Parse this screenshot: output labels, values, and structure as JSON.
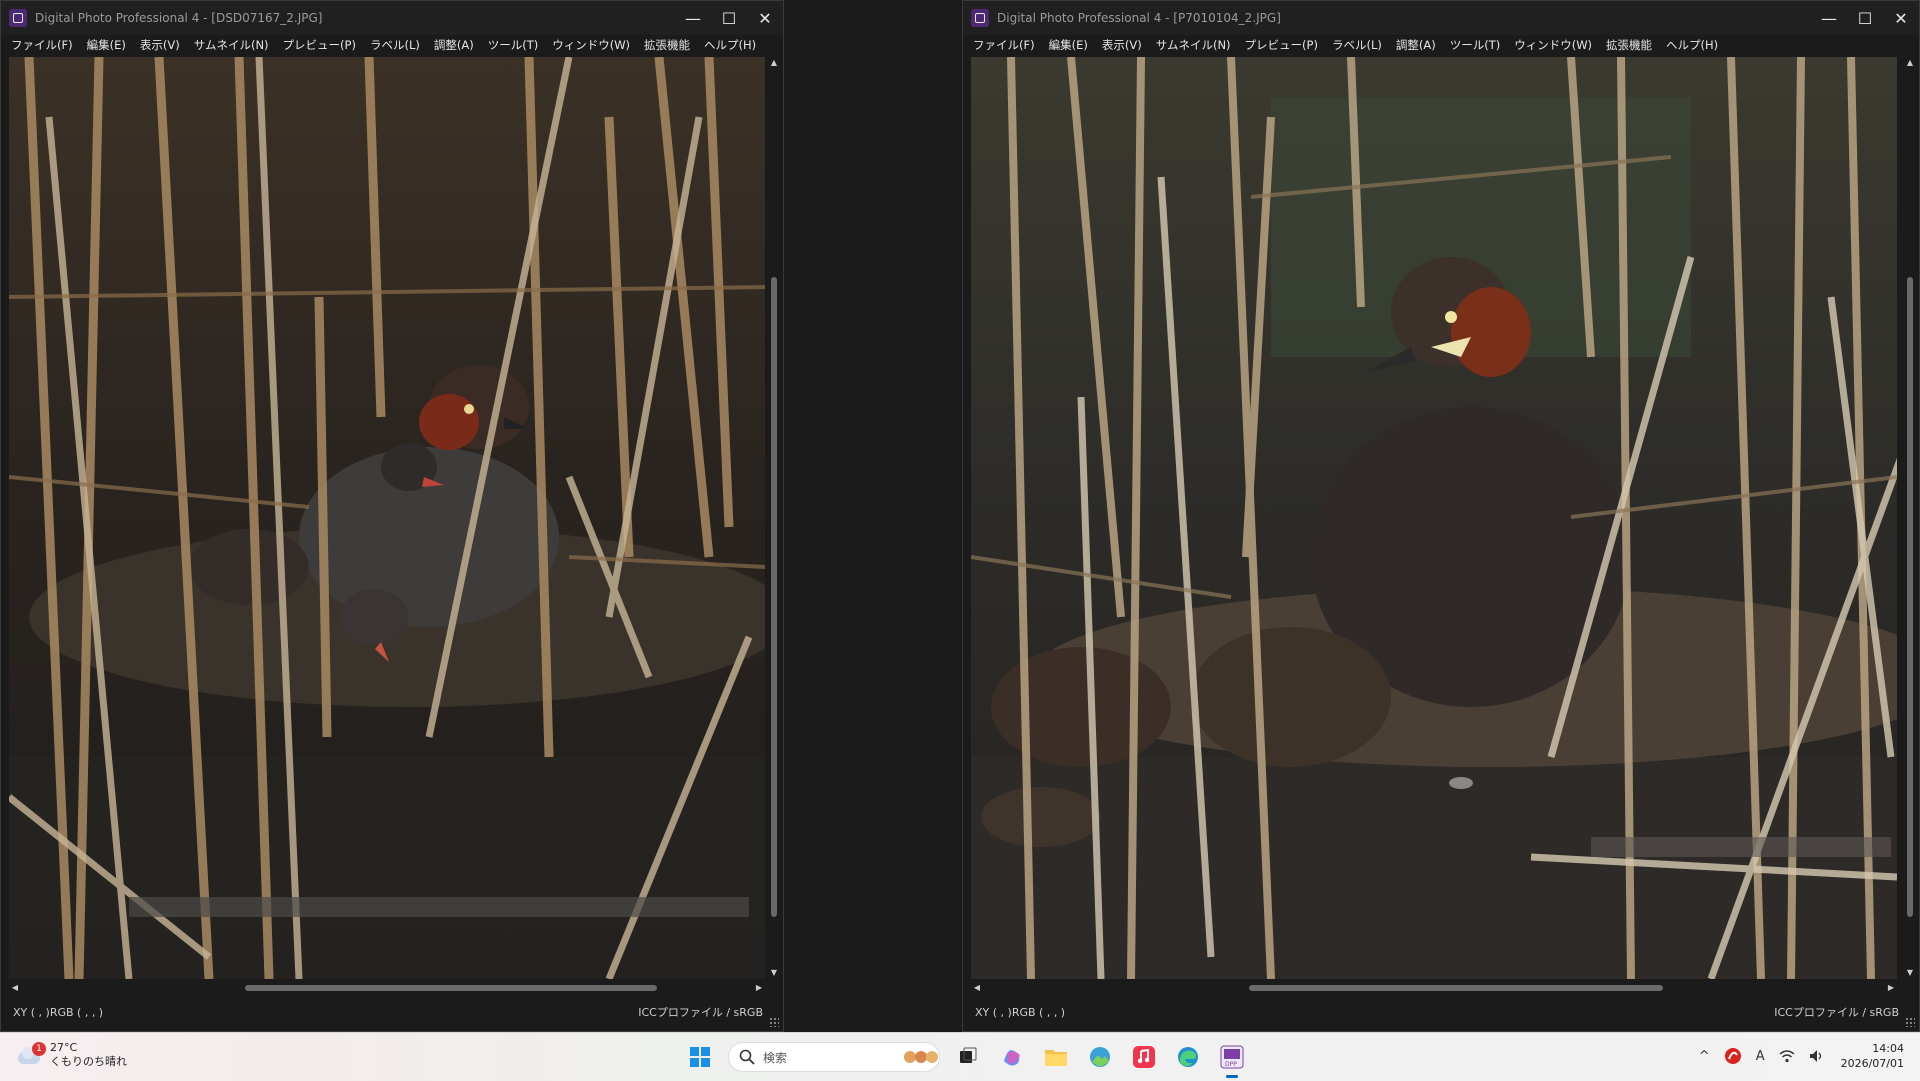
{
  "windows": [
    {
      "title": "Digital Photo Professional 4 - [DSD07167_2.JPG]",
      "menu": [
        "ファイル(F)",
        "編集(E)",
        "表示(V)",
        "サムネイル(N)",
        "プレビュー(P)",
        "ラベル(L)",
        "調整(A)",
        "ツール(T)",
        "ウィンドウ(W)",
        "拡張機能",
        "ヘルプ(H)"
      ],
      "status_left": "XY (  ,   )RGB (  ,  ,   )",
      "status_right": "ICCプロファイル / sRGB"
    },
    {
      "title": "Digital Photo Professional 4 - [P7010104_2.JPG]",
      "menu": [
        "ファイル(F)",
        "編集(E)",
        "表示(V)",
        "サムネイル(N)",
        "プレビュー(P)",
        "ラベル(L)",
        "調整(A)",
        "ツール(T)",
        "ウィンドウ(W)",
        "拡張機能",
        "ヘルプ(H)"
      ],
      "status_left": "XY (  ,   )RGB (  ,  ,   )",
      "status_right": "ICCプロファイル / sRGB"
    }
  ],
  "window_buttons": {
    "minimize": "—",
    "maximize": "☐",
    "close": "✕"
  },
  "taskbar": {
    "weather": {
      "badge": "1",
      "temp": "27°C",
      "condition": "くもりのち晴れ"
    },
    "search_placeholder": "検索",
    "apps": [
      "start-icon",
      "search-icon",
      "task-view-icon",
      "copilot-icon",
      "file-explorer-icon",
      "photos-icon",
      "music-icon",
      "edge-icon",
      "dpp-icon"
    ],
    "tray": {
      "chevron": "^",
      "ime": "A",
      "time": "14:04",
      "date": "2026/07/01"
    }
  },
  "colors": {
    "window_bg": "#1b1b1b",
    "titlebar": "#202020",
    "accent": "#0067c0"
  }
}
